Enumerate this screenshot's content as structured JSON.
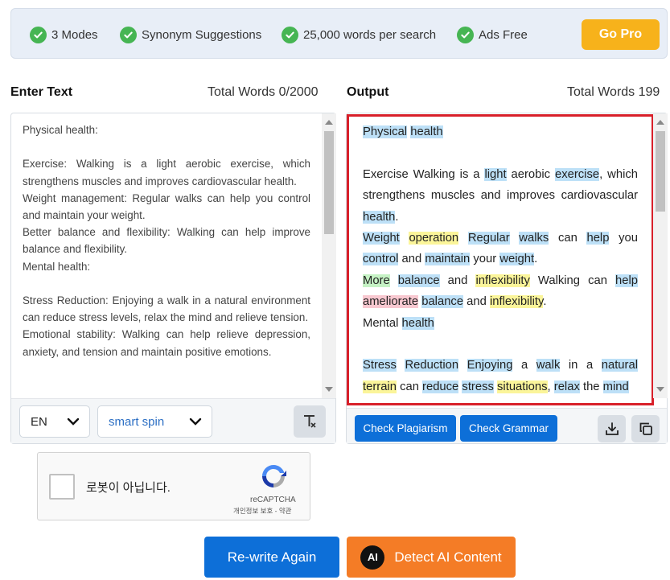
{
  "banner": {
    "features": [
      "3 Modes",
      "Synonym Suggestions",
      "25,000 words per search",
      "Ads Free"
    ],
    "go_pro": "Go Pro"
  },
  "input": {
    "title": "Enter Text",
    "word_count": "Total Words 0/2000",
    "paragraphs": [
      "Physical health:",
      "",
      "Exercise: Walking is a light aerobic exercise, which strengthens muscles and improves cardiovascular health.",
      "Weight management: Regular walks can help you control and maintain your weight.",
      "Better balance and flexibility: Walking can help improve balance and flexibility.",
      "Mental health:",
      "",
      "Stress Reduction: Enjoying a walk in a natural environment can reduce stress levels, relax the mind and relieve tension.",
      "Emotional stability: Walking can help relieve depression, anxiety, and tension and maintain positive emotions."
    ],
    "language": "EN",
    "mode": "smart spin"
  },
  "output": {
    "title": "Output",
    "word_count": "Total Words 199",
    "highlight_colors": {
      "synonym": "#bde0f7",
      "changed": "#fbf59a",
      "added": "#c5f2c4",
      "rare": "#f8c8d0"
    },
    "paragraphs": [
      [
        [
          "Physical",
          "b"
        ],
        " ",
        [
          "health",
          "b"
        ]
      ],
      [],
      [
        "Exercise Walking is a ",
        [
          "light",
          "b"
        ],
        " aerobic ",
        [
          "exercise",
          "b"
        ],
        ", which strengthens muscles and improves cardiovascular ",
        [
          "health",
          "b"
        ],
        "."
      ],
      [
        [
          "Weight",
          "b"
        ],
        " ",
        [
          "operation",
          "y"
        ],
        " ",
        [
          "Regular",
          "b"
        ],
        " ",
        [
          "walks",
          "b"
        ],
        " can ",
        [
          "help",
          "b"
        ],
        " you ",
        [
          "control",
          "b"
        ],
        " and ",
        [
          "maintain",
          "b"
        ],
        " your ",
        [
          "weight",
          "b"
        ],
        "."
      ],
      [
        [
          "More",
          "g"
        ],
        " ",
        [
          "balance",
          "b"
        ],
        " and ",
        [
          "inflexibility",
          "y"
        ],
        " Walking can ",
        [
          "help",
          "b"
        ],
        " ",
        [
          "ameliorate",
          "p"
        ],
        " ",
        [
          "balance",
          "b"
        ],
        " and ",
        [
          "inflexibility",
          "y"
        ],
        "."
      ],
      [
        "Mental ",
        [
          "health",
          "b"
        ]
      ],
      [],
      [
        [
          "Stress",
          "b"
        ],
        " ",
        [
          "Reduction",
          "b"
        ],
        " ",
        [
          "Enjoying",
          "b"
        ],
        " a ",
        [
          "walk",
          "b"
        ],
        " in a ",
        [
          "natural",
          "b"
        ],
        " ",
        [
          "terrain",
          "y"
        ],
        " can ",
        [
          "reduce",
          "b"
        ],
        " ",
        [
          "stress",
          "b"
        ],
        " ",
        [
          "situations",
          "y"
        ],
        ", ",
        [
          "relax",
          "b"
        ],
        " the ",
        [
          "mind",
          "b"
        ]
      ]
    ],
    "check_plagiarism": "Check Plagiarism",
    "check_grammar": "Check Grammar"
  },
  "captcha": {
    "label": "로봇이 아닙니다.",
    "brand": "reCAPTCHA",
    "links": "개인정보 보호 - 약관"
  },
  "actions": {
    "rewrite": "Re-write Again",
    "detect_ai": "Detect AI Content",
    "ai_badge": "AI"
  },
  "colors": {
    "primary": "#0d6fd8",
    "pro": "#f7b21b",
    "detect": "#f47c26",
    "check": "#46b553",
    "output_border": "#d8202a"
  }
}
